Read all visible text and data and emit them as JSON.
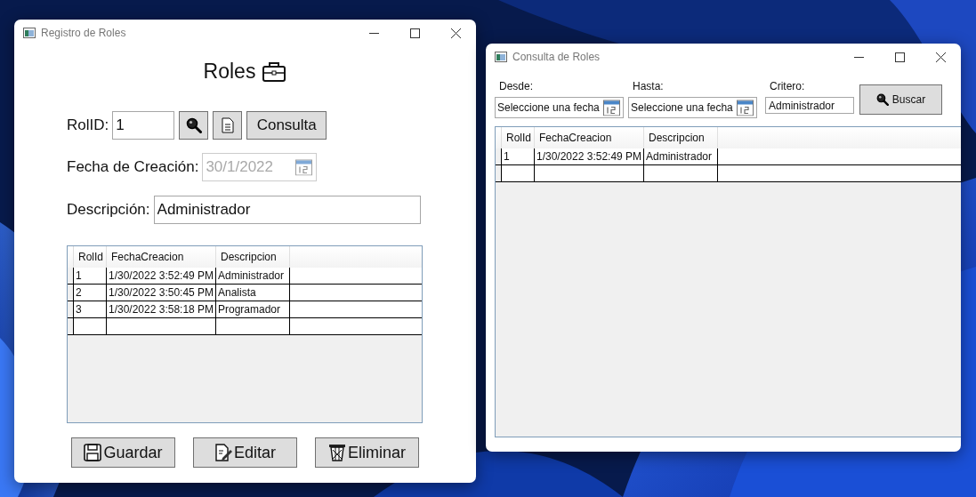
{
  "registro_window": {
    "title": "Registro de Roles",
    "heading": "Roles",
    "rol_id": {
      "label": "RolID:",
      "value": "1"
    },
    "consulta_button": "Consulta",
    "fecha": {
      "label": "Fecha de Creación:",
      "value": "30/1/2022",
      "disabled": true
    },
    "descripcion": {
      "label": "Descripción:",
      "value": "Administrador"
    },
    "table": {
      "columns": [
        "RolId",
        "FechaCreacion",
        "Descripcion"
      ],
      "rows": [
        [
          "1",
          "1/30/2022 3:52:49 PM",
          "Administrador"
        ],
        [
          "2",
          "1/30/2022 3:50:45 PM",
          "Analista"
        ],
        [
          "3",
          "1/30/2022 3:58:18 PM",
          "Programador"
        ]
      ]
    },
    "buttons": [
      {
        "kind": "save",
        "label": "Guardar"
      },
      {
        "kind": "edit",
        "label": "Editar"
      },
      {
        "kind": "delete",
        "label": "Eliminar"
      }
    ]
  },
  "consulta_window": {
    "title": "Consulta de Roles",
    "desde": {
      "label": "Desde:",
      "placeholder": "Seleccione una fecha"
    },
    "hasta": {
      "label": "Hasta:",
      "placeholder": "Seleccione una fecha"
    },
    "criterio": {
      "label": "Critero:",
      "value": "Administrador"
    },
    "search_button": "Buscar",
    "table": {
      "columns": [
        "RolId",
        "FechaCreacion",
        "Descripcion"
      ],
      "rows": [
        [
          "1",
          "1/30/2022 3:52:49 PM",
          "Administrador"
        ]
      ]
    }
  }
}
